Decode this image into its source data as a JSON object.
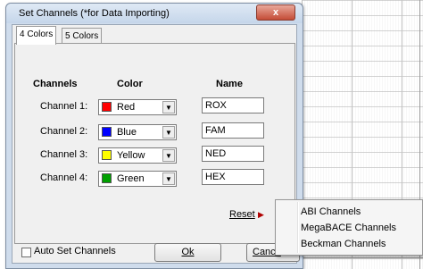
{
  "window": {
    "title": "Set Channels (*for  Data Importing)",
    "close_label": "x"
  },
  "tabs": [
    {
      "label": "4 Colors",
      "active": true
    },
    {
      "label": "5 Colors",
      "active": false
    }
  ],
  "headers": {
    "channels": "Channels",
    "color": "Color",
    "name": "Name"
  },
  "channels": [
    {
      "label": "Channel 1:",
      "color_label": "Red",
      "color": "#ff0000",
      "name": "ROX"
    },
    {
      "label": "Channel 2:",
      "color_label": "Blue",
      "color": "#0000ff",
      "name": "FAM"
    },
    {
      "label": "Channel 3:",
      "color_label": "Yellow",
      "color": "#ffff00",
      "name": "NED"
    },
    {
      "label": "Channel 4:",
      "color_label": "Green",
      "color": "#00a000",
      "name": "HEX"
    }
  ],
  "reset_label": "Reset",
  "auto_set_label": "Auto Set Channels",
  "ok_label": "Ok",
  "cancel_label": "Cance",
  "menu": {
    "items": [
      "ABI Channels",
      "MegaBACE Channels",
      "Beckman Channels"
    ]
  },
  "icons": {
    "dropdown": "chevron-down-icon",
    "reset_arrow": "submenu-arrow-icon"
  }
}
